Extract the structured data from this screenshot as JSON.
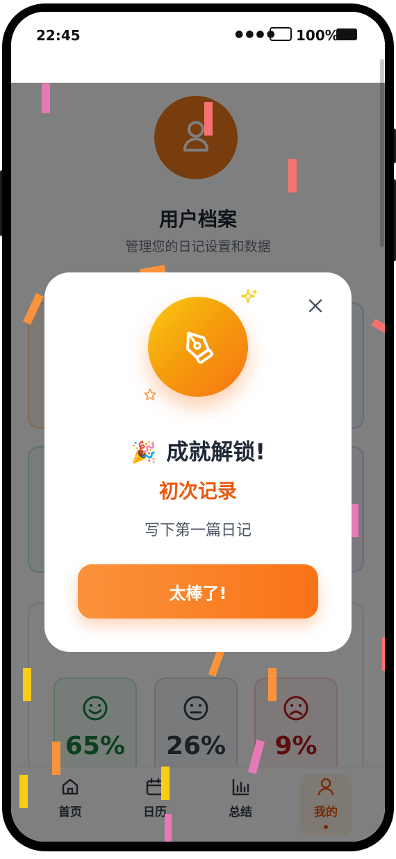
{
  "status_bar": {
    "time": "22:45",
    "battery": "100%"
  },
  "profile": {
    "title": "用户档案",
    "subtitle": "管理您的日记设置和数据"
  },
  "moods": [
    {
      "icon": "happy-face-icon",
      "percent": "65%",
      "color": "#15803d"
    },
    {
      "icon": "neutral-face-icon",
      "percent": "26%",
      "color": "#374151"
    },
    {
      "icon": "sad-face-icon",
      "percent": "9%",
      "color": "#b91c1c"
    }
  ],
  "tabbar": {
    "items": [
      {
        "label": "首页",
        "icon": "home-icon"
      },
      {
        "label": "日历",
        "icon": "calendar-icon"
      },
      {
        "label": "总结",
        "icon": "bar-chart-icon"
      },
      {
        "label": "我的",
        "icon": "user-icon",
        "active": true
      }
    ]
  },
  "modal": {
    "emoji": "🎉",
    "title": "成就解锁!",
    "achievement": "初次记录",
    "description": "写下第一篇日记",
    "confirm": "太棒了!",
    "badge_icon": "pen-nib-icon",
    "accent": "#f97316"
  }
}
